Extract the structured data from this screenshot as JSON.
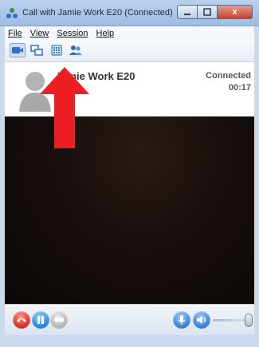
{
  "window": {
    "title": "Call with Jamie Work E20 (Connected)",
    "controls": {
      "close": "x"
    }
  },
  "menu": {
    "file": "File",
    "view": "View",
    "session": "Session",
    "help": "Help"
  },
  "toolbar": {
    "icons": [
      "video-icon",
      "windows-icon",
      "dialpad-icon",
      "contacts-icon"
    ]
  },
  "call": {
    "contact_name": "Jamie Work E20",
    "status": "Connected",
    "duration": "00:17"
  },
  "colors": {
    "annotation_arrow": "#ee1f23",
    "end_call": "#d8322a",
    "hold": "#2a8de3",
    "accent": "#3d86d6"
  },
  "controls": {
    "volume_level": 0.9
  }
}
